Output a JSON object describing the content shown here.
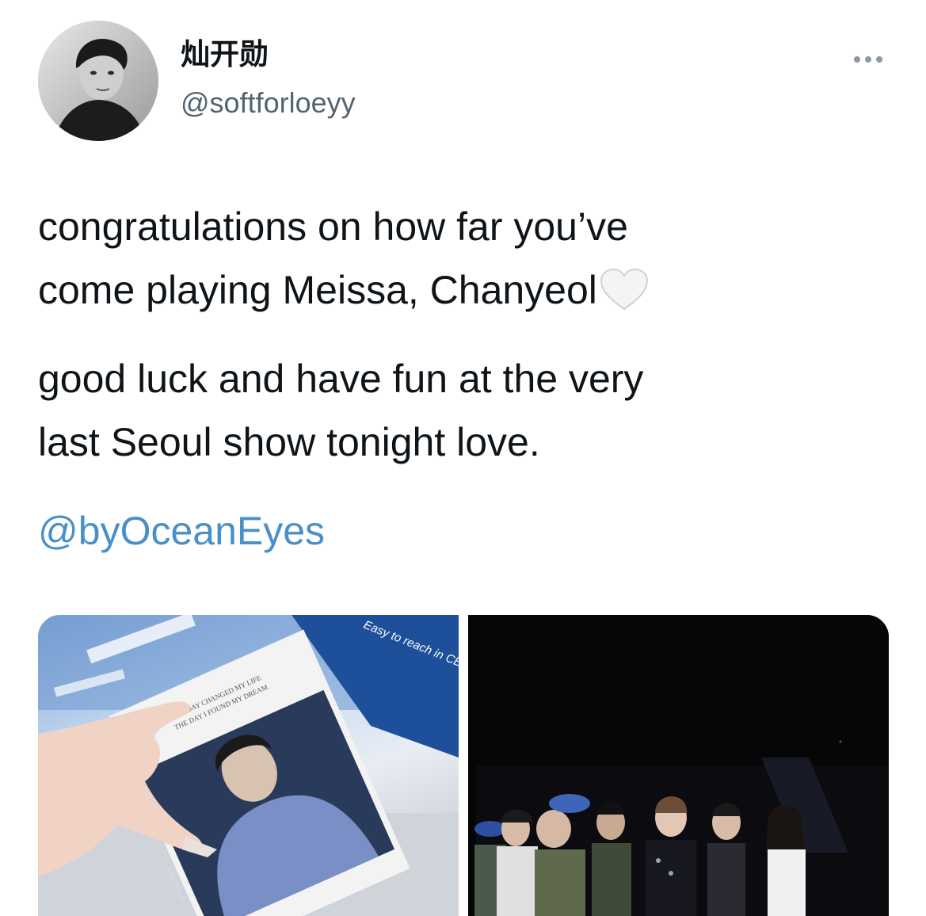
{
  "tweet": {
    "author": {
      "display_name": "灿开勋",
      "handle": "@softforloeyy"
    },
    "more_icon": "more-horizontal-icon",
    "paragraphs": [
      {
        "lines": [
          "congratulations on how far you’ve",
          "come playing Meissa, Chanyeol"
        ],
        "trailing_emoji": "white-heart-icon"
      },
      {
        "lines": [
          "good luck and have fun at the very",
          "last Seoul show tonight love."
        ]
      }
    ],
    "mention": "@byOceanEyes",
    "media": [
      {
        "kind": "photo",
        "printed_text": {
          "banner": "Easy to reach in CBD",
          "card_lines": [
            "THE DAY CHANGED MY LIFE",
            "THE DAY I FOUND MY DREAM"
          ],
          "card_title": "MEISSA"
        }
      },
      {
        "kind": "photo"
      }
    ]
  },
  "colors": {
    "text_primary": "#0f1419",
    "text_secondary": "#536471",
    "link": "#4a90c8"
  }
}
